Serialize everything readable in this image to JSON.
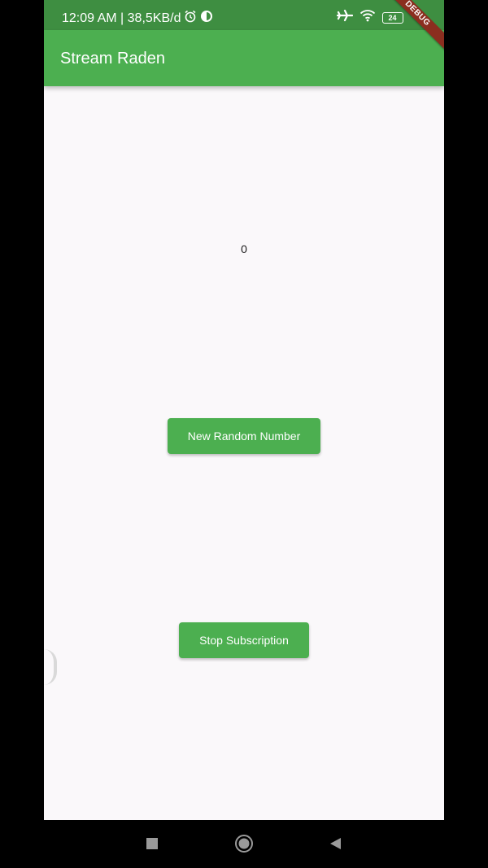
{
  "status_bar": {
    "time_speed": "12:09 AM | 38,5KB/d",
    "battery": "24",
    "icons": [
      "alarm-icon",
      "sync-icon",
      "airplane-icon",
      "wifi-icon",
      "battery-icon"
    ]
  },
  "app_bar": {
    "title": "Stream Raden",
    "debug_label": "DEBUG"
  },
  "main": {
    "counter_value": "0",
    "random_button_label": "New Random Number",
    "stop_button_label": "Stop Subscription"
  },
  "nav": {
    "icons": [
      "recents-icon",
      "home-icon",
      "back-icon"
    ]
  },
  "colors": {
    "status_bar": "#3e8e41",
    "app_bar": "#4caf50",
    "button": "#4caf50",
    "background": "#faf8fa",
    "debug_ribbon": "#8b2e1f"
  }
}
